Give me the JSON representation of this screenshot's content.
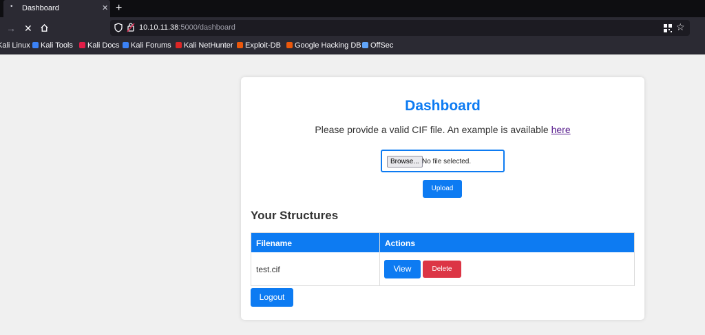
{
  "browser": {
    "tab_title": "Dashboard",
    "tab_favicon": "•",
    "tab_close": "✕",
    "new_tab": "+",
    "back_icon": "→",
    "stop_icon": "✕",
    "url_host": "10.10.11.38",
    "url_rest": ":5000/dashboard",
    "star_icon": "☆"
  },
  "bookmarks": [
    {
      "label": "Kali Linux",
      "icon_color": "#3b82f6"
    },
    {
      "label": "Kali Tools",
      "icon_color": "#3b82f6"
    },
    {
      "label": "Kali Docs",
      "icon_color": "#e11d48"
    },
    {
      "label": "Kali Forums",
      "icon_color": "#3b82f6"
    },
    {
      "label": "Kali NetHunter",
      "icon_color": "#dc2626"
    },
    {
      "label": "Exploit-DB",
      "icon_color": "#ea580c"
    },
    {
      "label": "Google Hacking DB",
      "icon_color": "#ea580c"
    },
    {
      "label": "OffSec",
      "icon_color": "#60a5fa"
    }
  ],
  "page": {
    "heading": "Dashboard",
    "intro_text": "Please provide a valid CIF file. An example is available ",
    "intro_link": "here",
    "browse_label": "Browse...",
    "no_file": "No file selected.",
    "upload_label": "Upload",
    "section_title": "Your Structures",
    "table": {
      "headers": [
        "Filename",
        "Actions"
      ],
      "rows": [
        {
          "filename": "test.cif",
          "view": "View",
          "delete": "Delete"
        }
      ]
    },
    "logout_label": "Logout"
  },
  "colors": {
    "primary": "#0d7bf2",
    "danger": "#dc3545",
    "page_bg": "#f0f0f0"
  }
}
